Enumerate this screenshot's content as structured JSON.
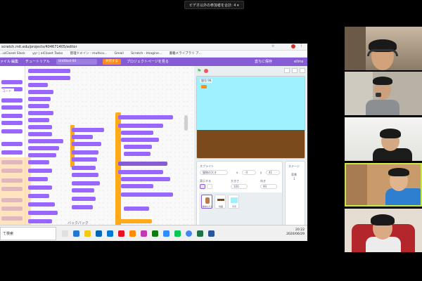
{
  "zoom_banner": "ビデオ以外の参加者を合計: 4",
  "browser": {
    "url": "scratch.mit.edu/projects/404671405/editor",
    "bookmarks": [
      "...oiCloset Slack",
      "yyr | oiCloset Tasks",
      "管理ドメイン - multica...",
      "Gmail",
      "Scratch - Imagine...",
      "書籍メライブラリ  ア..."
    ]
  },
  "scratch": {
    "menu_items": [
      "ァイル",
      "編集",
      "チュートリアル"
    ],
    "project_title": "Untitled-44",
    "share_label": "共有する",
    "project_page_label": "プロジェクトページを見る",
    "save_label": "直ちに保存",
    "user_label": "ellms",
    "tab_label": "コード",
    "backpack_label": "バックパック",
    "stage_tag": "猫号 98",
    "sprite_section_label": "スプライト",
    "sprite_name_value": "猫物の大き",
    "x_label": "x",
    "x_value": "-4",
    "y_label": "y",
    "y_value": "41",
    "show_label": "表示する",
    "size_label": "大きさ",
    "size_value": "100",
    "direction_label": "向き",
    "direction_value": "90",
    "stage_label": "ステージ",
    "backdrop_count_label": "背景",
    "backdrop_count": "1",
    "sprites": [
      "猫物の大き",
      "地面",
      "背景"
    ]
  },
  "taskbar": {
    "search_text": "て検索",
    "time": "20:22",
    "date": "2020/06/29"
  },
  "colors": {
    "scratch_purple": "#855cd6",
    "looks_purple": "#9966ff",
    "control_orange": "#ffab19",
    "sky": "#9ff1ff",
    "ground": "#7a4a1c",
    "active_speaker": "#c7e84b"
  }
}
